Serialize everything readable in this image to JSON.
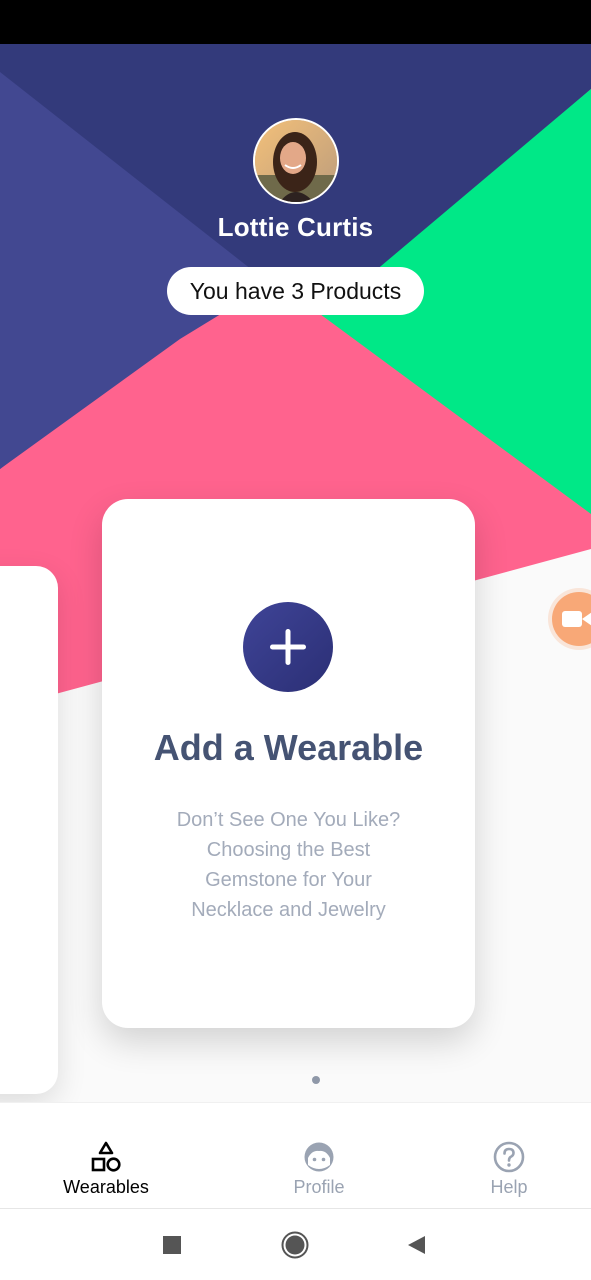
{
  "user": {
    "name": "Lottie Curtis",
    "products_text": "You have 3 Products"
  },
  "card": {
    "title": "Add a Wearable",
    "description": "Don’t See One You Like? Choosing the Best Gemstone for Your Necklace and Jewelry",
    "add_icon": "plus-icon"
  },
  "carousel": {
    "page_count": 1,
    "active_page": 1
  },
  "bottom_nav": {
    "items": [
      {
        "label": "Wearables",
        "icon": "shapes-icon",
        "active": true
      },
      {
        "label": "Profile",
        "icon": "face-icon",
        "active": false
      },
      {
        "label": "Help",
        "icon": "question-circle-icon",
        "active": false
      }
    ]
  },
  "colors": {
    "navy": "#333a7b",
    "indigo": "#424891",
    "green": "#00e887",
    "pink": "#ff638e",
    "card_title": "#455373",
    "card_text": "#a3abba",
    "fab": "#f8a877"
  }
}
